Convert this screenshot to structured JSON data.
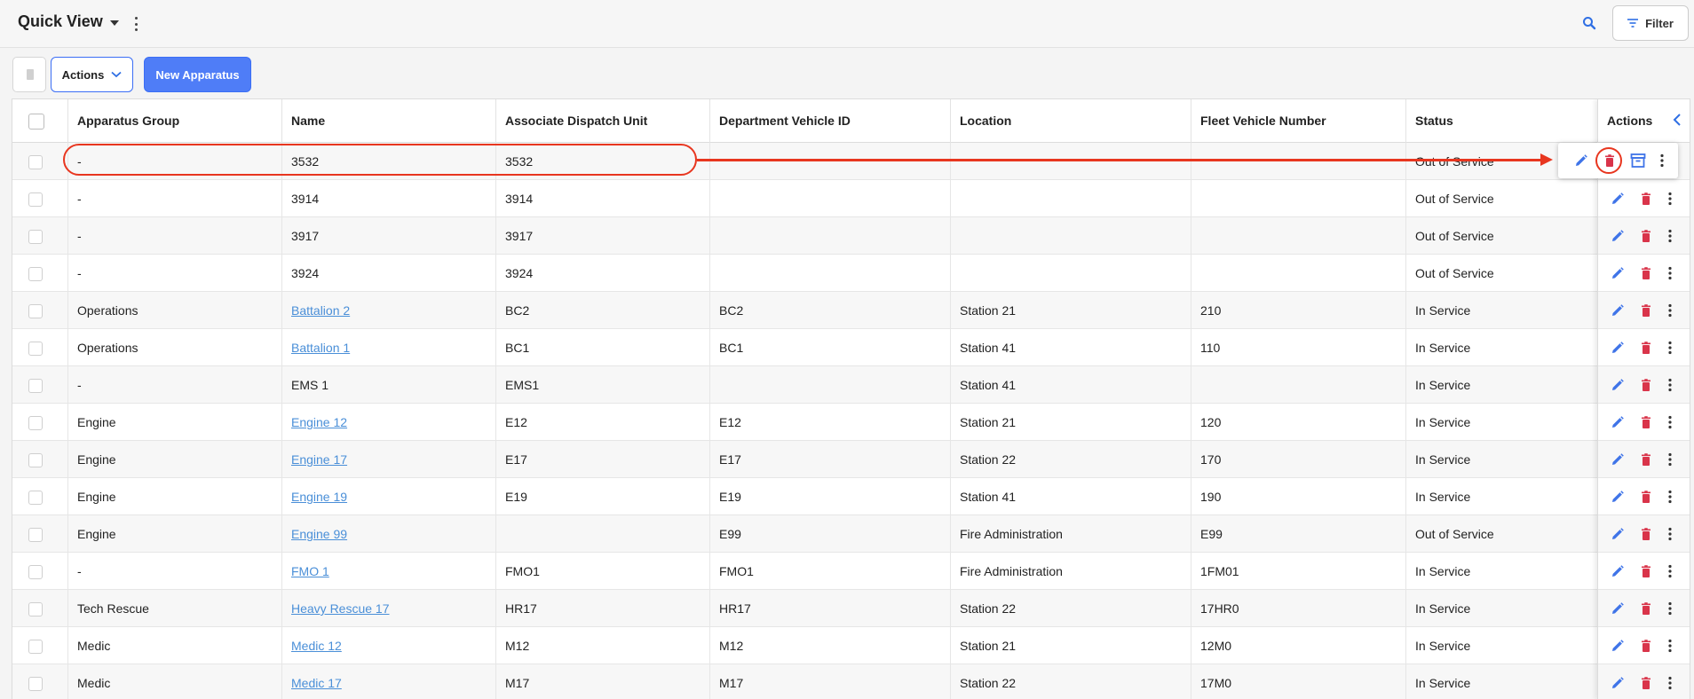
{
  "header": {
    "title": "Quick View",
    "filter_label": "Filter"
  },
  "toolbar": {
    "actions_label": "Actions",
    "new_label": "New Apparatus"
  },
  "table": {
    "columns": [
      "Apparatus Group",
      "Name",
      "Associate Dispatch Unit",
      "Department Vehicle ID",
      "Location",
      "Fleet Vehicle Number",
      "Status"
    ],
    "actions_header": "Actions",
    "rows": [
      {
        "group": "-",
        "name": "3532",
        "name_link": false,
        "dispatch": "3532",
        "vehicle_id": "",
        "location": "",
        "fleet": "",
        "status": "Out of Service"
      },
      {
        "group": "-",
        "name": "3914",
        "name_link": false,
        "dispatch": "3914",
        "vehicle_id": "",
        "location": "",
        "fleet": "",
        "status": "Out of Service"
      },
      {
        "group": "-",
        "name": "3917",
        "name_link": false,
        "dispatch": "3917",
        "vehicle_id": "",
        "location": "",
        "fleet": "",
        "status": "Out of Service"
      },
      {
        "group": "-",
        "name": "3924",
        "name_link": false,
        "dispatch": "3924",
        "vehicle_id": "",
        "location": "",
        "fleet": "",
        "status": "Out of Service"
      },
      {
        "group": "Operations",
        "name": "Battalion 2",
        "name_link": true,
        "dispatch": "BC2",
        "vehicle_id": "BC2",
        "location": "Station 21",
        "fleet": "210",
        "status": "In Service"
      },
      {
        "group": "Operations",
        "name": "Battalion 1",
        "name_link": true,
        "dispatch": "BC1",
        "vehicle_id": "BC1",
        "location": "Station 41",
        "fleet": "110",
        "status": "In Service"
      },
      {
        "group": "-",
        "name": "EMS 1",
        "name_link": false,
        "dispatch": "EMS1",
        "vehicle_id": "",
        "location": "Station 41",
        "fleet": "",
        "status": "In Service"
      },
      {
        "group": "Engine",
        "name": "Engine 12",
        "name_link": true,
        "dispatch": "E12",
        "vehicle_id": "E12",
        "location": "Station 21",
        "fleet": "120",
        "status": "In Service"
      },
      {
        "group": "Engine",
        "name": "Engine 17",
        "name_link": true,
        "dispatch": "E17",
        "vehicle_id": "E17",
        "location": "Station 22",
        "fleet": "170",
        "status": "In Service"
      },
      {
        "group": "Engine",
        "name": "Engine 19",
        "name_link": true,
        "dispatch": "E19",
        "vehicle_id": "E19",
        "location": "Station 41",
        "fleet": "190",
        "status": "In Service"
      },
      {
        "group": "Engine",
        "name": "Engine 99",
        "name_link": true,
        "dispatch": "",
        "vehicle_id": "E99",
        "location": "Fire Administration",
        "fleet": "E99",
        "status": "Out of Service"
      },
      {
        "group": "-",
        "name": "FMO 1",
        "name_link": true,
        "dispatch": "FMO1",
        "vehicle_id": "FMO1",
        "location": "Fire Administration",
        "fleet": "1FM01",
        "status": "In Service"
      },
      {
        "group": "Tech Rescue",
        "name": "Heavy Rescue 17",
        "name_link": true,
        "dispatch": "HR17",
        "vehicle_id": "HR17",
        "location": "Station 22",
        "fleet": "17HR0",
        "status": "In Service"
      },
      {
        "group": "Medic",
        "name": "Medic 12",
        "name_link": true,
        "dispatch": "M12",
        "vehicle_id": "M12",
        "location": "Station 21",
        "fleet": "12M0",
        "status": "In Service"
      },
      {
        "group": "Medic",
        "name": "Medic 17",
        "name_link": true,
        "dispatch": "M17",
        "vehicle_id": "M17",
        "location": "Station 22",
        "fleet": "17M0",
        "status": "In Service"
      }
    ]
  },
  "icons": {
    "edit": "pencil-icon",
    "delete": "trash-icon",
    "archive": "archive-icon",
    "more": "kebab-icon"
  },
  "colors": {
    "primary": "#4f7df7",
    "link": "#4a8fd8",
    "delete": "#d9344a",
    "annotation": "#e8361f"
  }
}
